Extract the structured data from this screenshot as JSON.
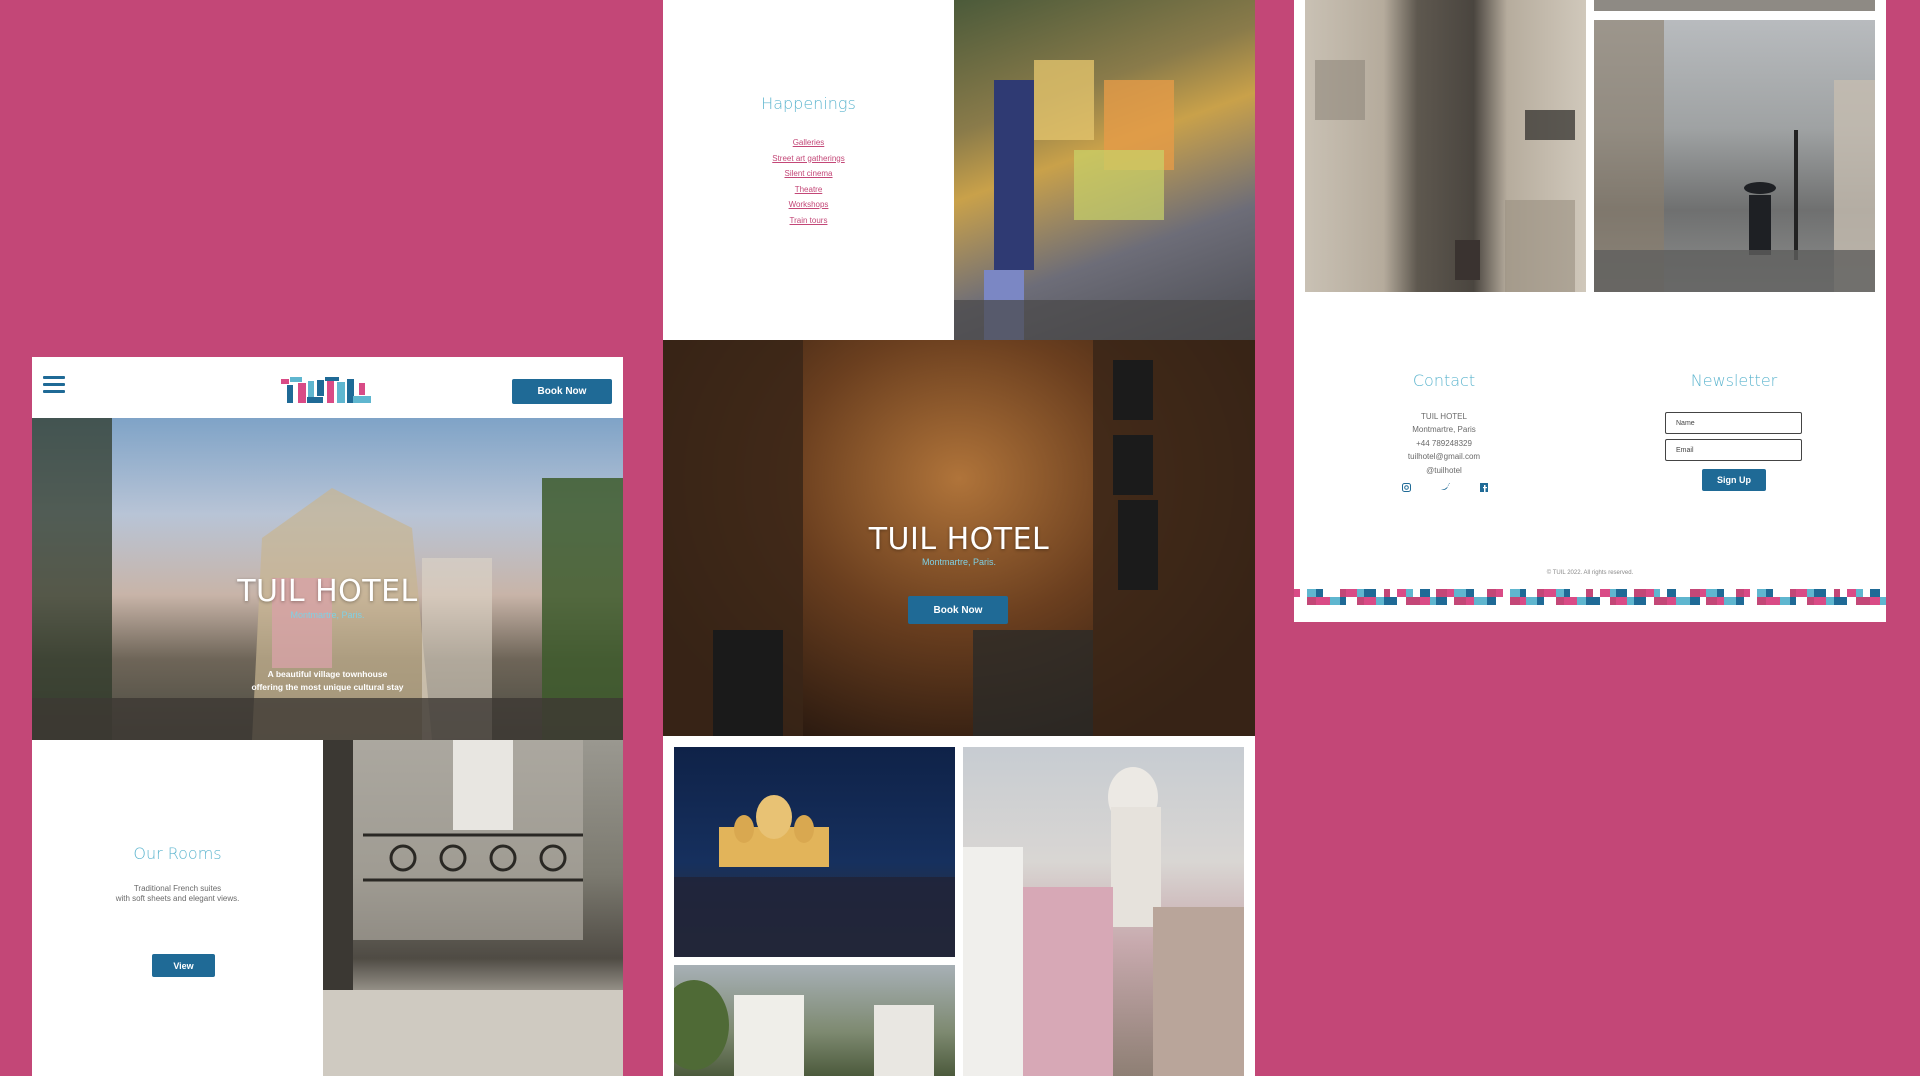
{
  "colors": {
    "background": "#c34777",
    "accent_blue": "#1f6a96",
    "title_teal": "#5fb6cf",
    "link_pink": "#c34777"
  },
  "panel1": {
    "menu_icon": "hamburger-icon",
    "book_now": "Book Now",
    "hero": {
      "title": "TUIL HOTEL",
      "subtitle": "Montmartre, Paris.",
      "tagline_line1": "A beautiful village townhouse",
      "tagline_line2": "offering the most unique cultural stay"
    },
    "rooms": {
      "title": "Our Rooms",
      "desc_line1": "Traditional French suites",
      "desc_line2": "with soft sheets and elegant views.",
      "button": "View"
    }
  },
  "panel2": {
    "happenings": {
      "title": "Happenings",
      "links": [
        "Galleries",
        "Street art gatherings",
        "Silent cinema",
        "Theatre",
        "Workshops",
        "Train tours"
      ]
    },
    "hero": {
      "title": "TUIL HOTEL",
      "subtitle": "Montmartre, Paris.",
      "button": "Book Now"
    }
  },
  "panel3": {
    "contact": {
      "title": "Contact",
      "lines": [
        "TUIL HOTEL",
        "Montmartre, Paris",
        "+44 789248329",
        "tuilhotel@gmail.com",
        "@tuilhotel"
      ],
      "icons": [
        "instagram-icon",
        "twitter-icon",
        "facebook-icon"
      ]
    },
    "newsletter": {
      "title": "Newsletter",
      "name_placeholder": "Name",
      "email_placeholder": "Email",
      "button": "Sign Up"
    },
    "copyright": "© TUIL 2022. All rights reserved."
  }
}
